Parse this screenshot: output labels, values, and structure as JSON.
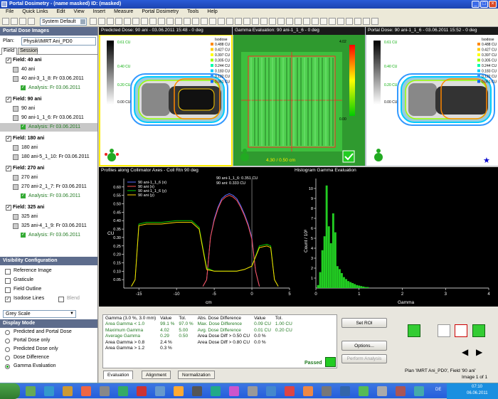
{
  "window": {
    "title": "Portal Dosimetry - (name masked)  ID: (masked)"
  },
  "menu": [
    "File",
    "Quick Links",
    "Edit",
    "View",
    "Insert",
    "Measure",
    "Portal Dosimetry",
    "Tools",
    "Help"
  ],
  "toolbar": {
    "system_select": "System Default"
  },
  "sidebar": {
    "title": "Portal Dose Images",
    "plan_label": "Plan:",
    "plan_value": "Physik\\IMRT Ani_PD0",
    "tabs": [
      "Field",
      "Session"
    ],
    "fields": [
      {
        "name": "Field: 40 ani",
        "image": "40 ani",
        "pred": "40 ani-3_1_8: Fr 03.06.2011",
        "analysis": "Analysis: Fr 03.06.2011"
      },
      {
        "name": "Field: 90 ani",
        "image": "90 ani",
        "pred": "90 ani-1_1_6: Fr 03.06.2011",
        "analysis": "Analysis: Fr 03.06.2011"
      },
      {
        "name": "Field: 180 ani",
        "image": "180 ani",
        "pred": "180 ani-5_1_10: Fr 03.06.2011",
        "analysis": null
      },
      {
        "name": "Field: 270 ani",
        "image": "270 ani",
        "pred": "270 ani-2_1_7: Fr 03.06.2011",
        "analysis": "Analysis: Fr 03.06.2011"
      },
      {
        "name": "Field: 325 ani",
        "image": "325 ani",
        "pred": "325 ani-4_1_9: Fr 03.06.2011",
        "analysis": "Analysis: Fr 03.06.2011"
      }
    ],
    "visibility": {
      "title": "Visibility Configuration",
      "items": [
        {
          "label": "Reference Image",
          "checked": false
        },
        {
          "label": "Graticule",
          "checked": false
        },
        {
          "label": "Field Outline",
          "checked": false
        },
        {
          "label": "Isodose Lines",
          "checked": true
        },
        {
          "label": "Blend",
          "checked": false
        }
      ],
      "color_scale": "Grey Scale"
    },
    "display_mode": {
      "title": "Display Mode",
      "options": [
        {
          "label": "Predicted and Portal Dose",
          "selected": false
        },
        {
          "label": "Portal Dose only",
          "selected": false
        },
        {
          "label": "Predicted Dose only",
          "selected": false
        },
        {
          "label": "Dose Difference",
          "selected": false
        },
        {
          "label": "Gamma Evaluation",
          "selected": true
        }
      ]
    }
  },
  "panels": {
    "predicted": {
      "title": "Predicted Dose: 90 ani - 03.06.2011 15:48 - 0 deg",
      "max": "0.61 CU",
      "mid1": "0.40 CU",
      "mid2": "0.20 CU",
      "low": "0.00 CU",
      "isodose_title": "Isodose",
      "isodose": [
        "0.488 CU",
        "0.427 CU",
        "0.397 CU",
        "0.305 CU",
        "0.244 CU",
        "0.183 CU",
        "0.122 CU",
        "0.061 CU"
      ],
      "isodose_colors": [
        "#ff8800",
        "#ffcc00",
        "#ffff00",
        "#99ff00",
        "#00ffaa",
        "#00ccff",
        "#3399ff",
        "#0066ff"
      ]
    },
    "gamma": {
      "title": "Gamma Evaluation: 90 ani-1_1_6 - 0 deg",
      "scale_top": "4.02",
      "scale_bottom": "0.00",
      "readout": "4.30 / 0.50 cm"
    },
    "portal": {
      "title": "Portal Dose: 90 ani-1_1_6 - 03.06.2011 15:52 - 0 deg",
      "max": "0.61 CU",
      "mid1": "0.40 CU",
      "mid2": "0.20 CU",
      "low": "0.00 CU",
      "isodose_title": "Isodose",
      "isodose": [
        "0.488 CU",
        "0.427 CU",
        "0.397 CU",
        "0.305 CU",
        "0.244 CU",
        "0.183 CU",
        "0.122 CU",
        "0.061 CU"
      ]
    }
  },
  "profiles": {
    "title": "Profiles along Collimator Axes - Coll Rtn 90 deg",
    "readout1": "90 ani-1_1_6: 0.351 CU",
    "readout2": "90 ani: 0.333 CU",
    "ylabel": "CU",
    "xlabel": "cm"
  },
  "histogram": {
    "title": "Histogram Gamma Evaluation",
    "xlabel": "Gamma",
    "ylabel": "Count / 10³"
  },
  "chart_data": [
    {
      "type": "line",
      "title": "Profiles along Collimator Axes - Coll Rtn 90 deg",
      "xlabel": "cm",
      "ylabel": "CU",
      "xlim": [
        -17,
        5
      ],
      "ylim": [
        0,
        0.65
      ],
      "xticks": [
        -15,
        -10,
        -5,
        0,
        5
      ],
      "yticks": [
        0.05,
        0.1,
        0.15,
        0.2,
        0.25,
        0.3,
        0.35,
        0.4,
        0.45,
        0.5,
        0.55,
        0.6
      ],
      "series": [
        {
          "name": "90 ani-1_1_6 (x)",
          "color": "#5a6cff",
          "x": [
            -6.5,
            -6,
            -5.5,
            -5,
            -4.5,
            -4,
            -3.5,
            -3,
            -2.5,
            -2,
            -1.5,
            -1,
            -0.5,
            0,
            0.5,
            1
          ],
          "y": [
            0.01,
            0.05,
            0.3,
            0.41,
            0.48,
            0.53,
            0.55,
            0.56,
            0.55,
            0.53,
            0.49,
            0.44,
            0.38,
            0.3,
            0.1,
            0.01
          ]
        },
        {
          "name": "90 ani (x)",
          "color": "#ff5050",
          "x": [
            -6.5,
            -6,
            -5.5,
            -5,
            -4.5,
            -4,
            -3.5,
            -3,
            -2.5,
            -2,
            -1.5,
            -1,
            -0.5,
            0,
            0.5,
            1
          ],
          "y": [
            0.01,
            0.05,
            0.3,
            0.4,
            0.47,
            0.52,
            0.54,
            0.55,
            0.54,
            0.52,
            0.48,
            0.43,
            0.37,
            0.29,
            0.1,
            0.01
          ]
        },
        {
          "name": "90 ani-1_1_6 (y)",
          "color": "#00cc00",
          "x": [
            -16,
            -15.5,
            -15,
            -14,
            -12,
            -10,
            -8,
            -7,
            -6,
            -5,
            -4,
            -3,
            -2,
            -1,
            0,
            1,
            2,
            2.5,
            3,
            3.5
          ],
          "y": [
            0.01,
            0.05,
            0.38,
            0.39,
            0.39,
            0.4,
            0.4,
            0.36,
            0.12,
            0.1,
            0.1,
            0.1,
            0.1,
            0.11,
            0.13,
            0.25,
            0.26,
            0.25,
            0.05,
            0.01
          ]
        },
        {
          "name": "90 ani (y)",
          "color": "#ffd700",
          "x": [
            -16,
            -15.5,
            -15,
            -14,
            -12,
            -10,
            -8,
            -7,
            -6,
            -5,
            -4,
            -3,
            -2,
            -1,
            0,
            1,
            2,
            2.5,
            3,
            3.5
          ],
          "y": [
            0.01,
            0.05,
            0.37,
            0.38,
            0.38,
            0.39,
            0.39,
            0.35,
            0.11,
            0.1,
            0.1,
            0.1,
            0.1,
            0.11,
            0.13,
            0.24,
            0.25,
            0.24,
            0.05,
            0.01
          ]
        }
      ]
    },
    {
      "type": "bar",
      "title": "Histogram Gamma Evaluation",
      "xlabel": "Gamma",
      "ylabel": "Count / 10³",
      "xlim": [
        0,
        4
      ],
      "ylim": [
        0,
        11
      ],
      "xticks": [
        0,
        1,
        2,
        3,
        4
      ],
      "yticks": [
        1,
        2,
        3,
        4,
        5,
        6,
        7,
        8,
        9,
        10
      ],
      "bin_centers": [
        0.05,
        0.1,
        0.15,
        0.2,
        0.25,
        0.3,
        0.35,
        0.4,
        0.45,
        0.5,
        0.55,
        0.6,
        0.65,
        0.7,
        0.75,
        0.8,
        0.85,
        0.9,
        0.95,
        1.0,
        1.05,
        1.1,
        1.15,
        1.2
      ],
      "values": [
        0.3,
        1.6,
        3.8,
        5.2,
        10.3,
        6.2,
        4.5,
        7.5,
        5.6,
        2.2,
        1.9,
        1.5,
        1.1,
        0.9,
        0.7,
        0.6,
        0.5,
        0.4,
        0.3,
        0.25,
        0.2,
        0.15,
        0.1,
        0.1
      ]
    }
  ],
  "results": {
    "header": [
      "Gamma (3.0 %, 3.0 mm)",
      "Value",
      "Tol.",
      "Abs. Dose Difference",
      "Value",
      "Tol."
    ],
    "rows": [
      [
        "Area Gamma < 1.0",
        "99.1 %",
        "97.0 %",
        "Max. Dose Difference",
        "0.09 CU",
        "1.00 CU"
      ],
      [
        "Maximum Gamma",
        "4.02",
        "5.00",
        "Avg. Dose Difference",
        "0.01 CU",
        "0.20 CU"
      ],
      [
        "Average Gamma",
        "0.29",
        "0.50",
        "Area Dose Diff > 0.50 CU",
        "0.0 %",
        ""
      ],
      [
        "Area Gamma > 0.8",
        "2.4 %",
        "",
        "Area Dose Diff > 0.80 CU",
        "0.0 %",
        ""
      ],
      [
        "Area Gamma > 1.2",
        "0.3 %",
        "",
        "",
        "",
        ""
      ]
    ],
    "passed": "Passed"
  },
  "buttons": {
    "set_roi": "Set ROI",
    "options": "Options...",
    "perform": "Perform Analysis"
  },
  "bottom_tabs": [
    "Evaluation",
    "Alignment",
    "Normalization"
  ],
  "status": {
    "plan": "Plan 'IMRT Ani_PD0', Field '90 ani'",
    "image": "Image 1 of 1"
  },
  "taskbar": {
    "lang": "DE",
    "time": "07:10",
    "date": "06.06.2011"
  }
}
